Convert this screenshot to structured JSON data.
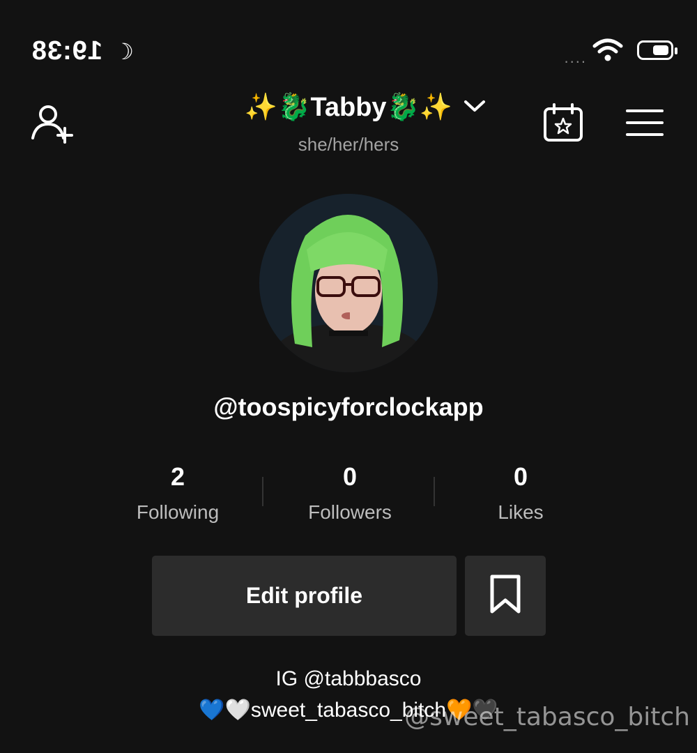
{
  "status_bar": {
    "time": "19:38",
    "moon_icon": "moon-icon",
    "battery_icon": "battery-icon",
    "wifi_icon": "wifi-icon",
    "signal_text": "...."
  },
  "header": {
    "title": "✨🐉Tabby🐉✨",
    "pronouns": "she/her/hers",
    "menu_icon": "hamburger-menu-icon",
    "calendar_icon": "calendar-star-icon",
    "add_user_icon": "add-user-icon",
    "chevron_icon": "chevron-down-icon"
  },
  "profile": {
    "username": "@toospicyforclockapp"
  },
  "stats": {
    "following": {
      "value": "2",
      "label": "Following"
    },
    "followers": {
      "value": "0",
      "label": "Followers"
    },
    "likes": {
      "value": "0",
      "label": "Likes"
    }
  },
  "actions": {
    "edit_profile_label": "Edit profile",
    "bookmark_icon": "bookmark-icon"
  },
  "bio": {
    "line1": "IG @tabbbasco",
    "line2": "💙🤍sweet_tabasco_bitch🧡🖤"
  },
  "watermark": "@sweet_tabasco_bitch",
  "colors": {
    "background": "#121212",
    "button_bg": "#2c2c2c",
    "muted_text": "#a3a3a3"
  }
}
